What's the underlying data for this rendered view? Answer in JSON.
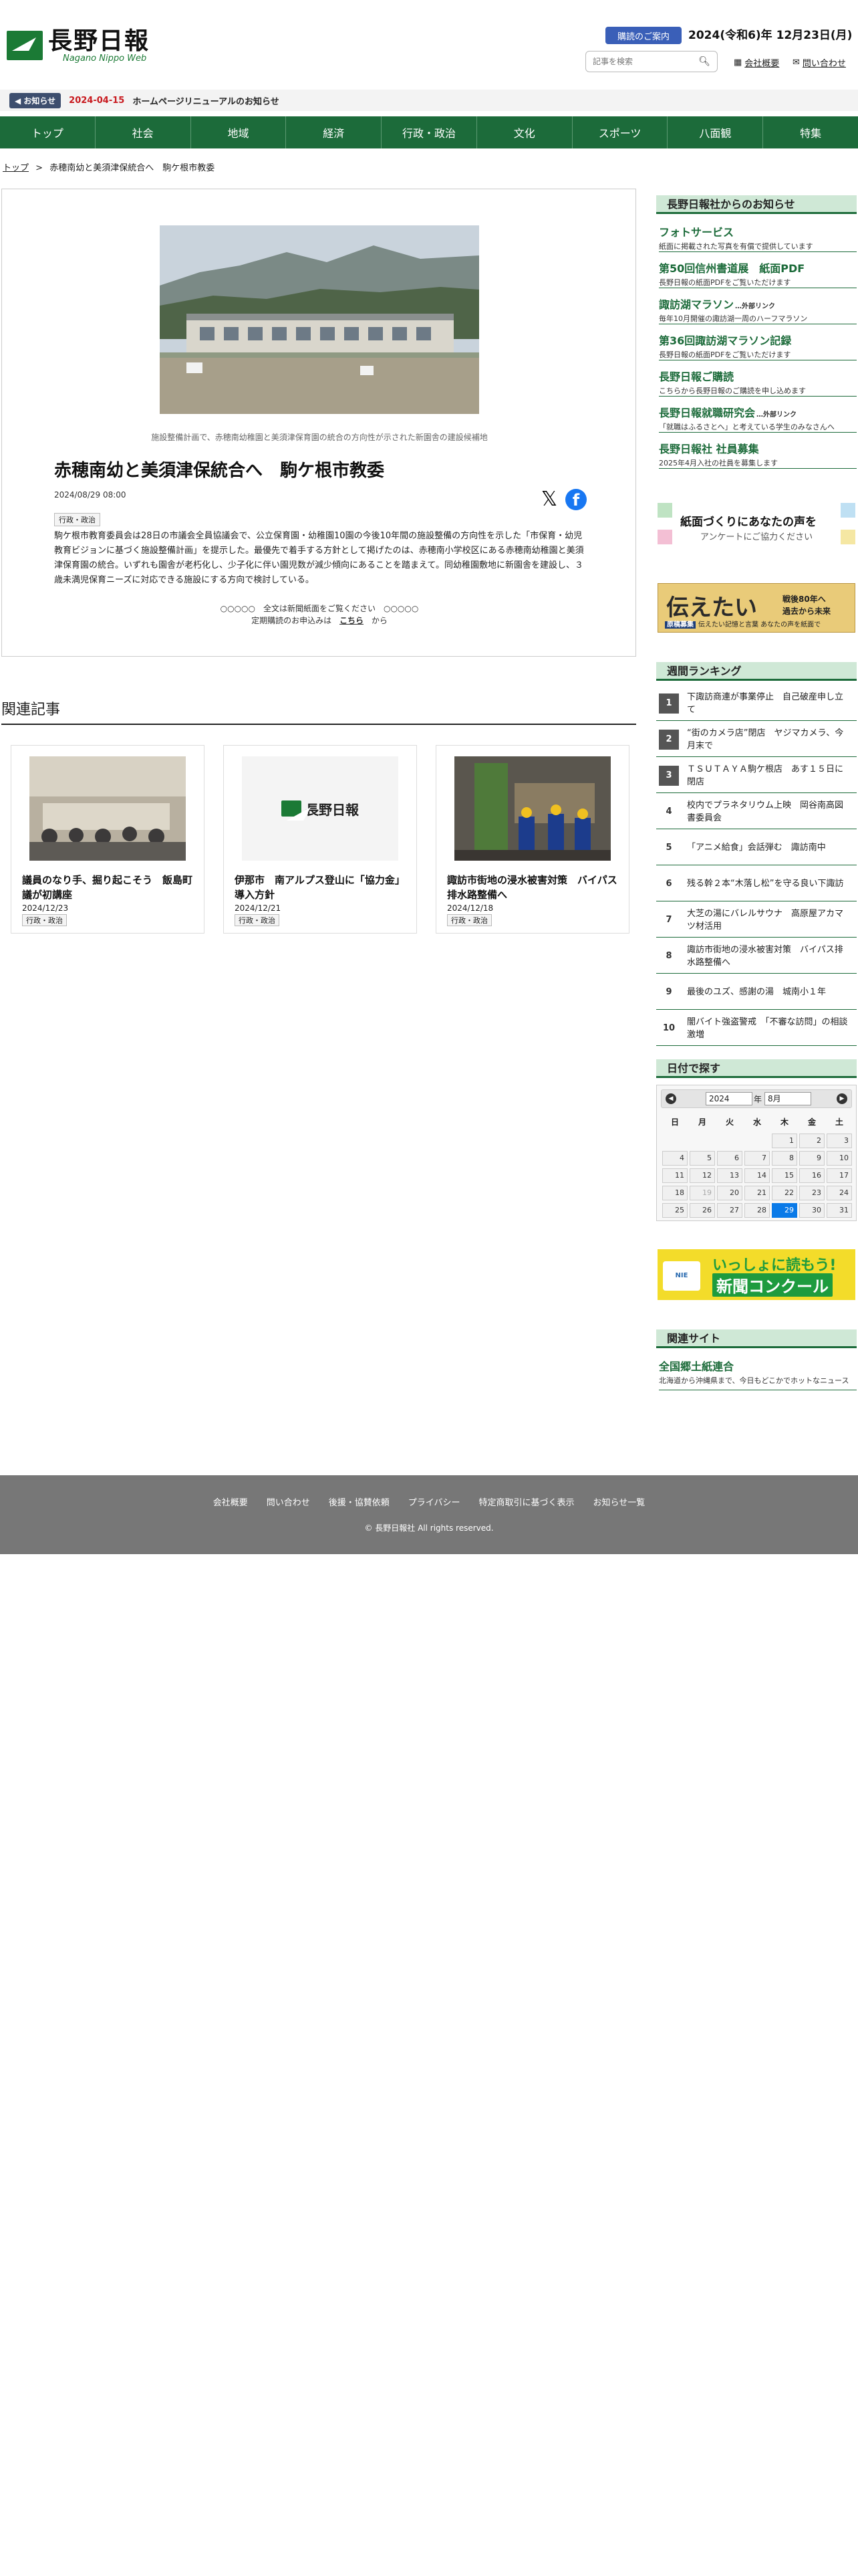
{
  "header": {
    "logo_title": "長野日報",
    "logo_sub": "Nagano Nippo Web",
    "subscribe_label": "購読のご案内",
    "date": "2024(令和6)年 12月23日(月)",
    "search_placeholder": "記事を検索",
    "company_link": "会社概要",
    "contact_link": "問い合わせ"
  },
  "notice": {
    "badge": "◀ お知らせ",
    "date": "2024-04-15",
    "text": "ホームページリニューアルのお知らせ"
  },
  "nav": [
    "トップ",
    "社会",
    "地域",
    "経済",
    "行政・政治",
    "文化",
    "スポーツ",
    "八面観",
    "特集"
  ],
  "breadcrumb": {
    "top": "トップ",
    "sep": ">",
    "current": "赤穂南幼と美須津保統合へ　駒ケ根市教委"
  },
  "article": {
    "caption": "施設整備計画で、赤穂南幼稚園と美須津保育園の統合の方向性が示された新園舎の建設候補地",
    "title": "赤穂南幼と美須津保統合へ　駒ケ根市教委",
    "date": "2024/08/29 08:00",
    "category": "行政・政治",
    "body": "駒ケ根市教育委員会は28日の市議会全員協議会で、公立保育園・幼稚園10園の今後10年間の施設整備の方向性を示した「市保育・幼児教育ビジョンに基づく施設整備計画」を提示した。最優先で着手する方針として掲げたのは、赤穂南小学校区にある赤穂南幼稚園と美須津保育園の統合。いずれも園舎が老朽化し、少子化に伴い園児数が減少傾向にあることを踏まえて。同幼稚園敷地に新園舎を建設し、３歳未満児保育ニーズに対応できる施設にする方向で検討している。",
    "paywall_line1": "○○○○○　全文は新聞紙面をご覧ください　○○○○○",
    "paywall_pre": "定期購読のお申込みは",
    "paywall_link": "こちら",
    "paywall_post": "から"
  },
  "related": {
    "heading": "関連記事",
    "items": [
      {
        "title": "議員のなり手、掘り起こそう　飯島町議が初講座",
        "date": "2024/12/23",
        "tag": "行政・政治"
      },
      {
        "title": "伊那市　南アルプス登山に「協力金」導入方針",
        "date": "2024/12/21",
        "tag": "行政・政治"
      },
      {
        "title": "諏訪市街地の浸水被害対策　バイパス排水路整備へ",
        "date": "2024/12/18",
        "tag": "行政・政治"
      }
    ]
  },
  "sidebar": {
    "news_heading": "長野日報社からのお知らせ",
    "news": [
      {
        "title": "フォトサービス",
        "badge": "",
        "sub": "紙面に掲載された写真を有償で提供しています"
      },
      {
        "title": "第50回信州書道展　紙面PDF",
        "badge": "",
        "sub": "長野日報の紙面PDFをご覧いただけます"
      },
      {
        "title": "諏訪湖マラソン",
        "badge": "…外部リンク",
        "sub": "毎年10月開催の諏訪湖一周のハーフマラソン"
      },
      {
        "title": "第36回諏訪湖マラソン記録",
        "badge": "",
        "sub": "長野日報の紙面PDFをご覧いただけます"
      },
      {
        "title": "長野日報ご購読",
        "badge": "",
        "sub": "こちらから長野日報のご購読を申し込めます"
      },
      {
        "title": "長野日報就職研究会",
        "badge": "…外部リンク",
        "sub": "「就職はふるさとへ」と考えている学生のみなさんへ"
      },
      {
        "title": "長野日報社 社員募集",
        "badge": "",
        "sub": "2025年4月入社の社員を募集します"
      }
    ],
    "banner1_title": "紙面づくりにあなたの声を",
    "banner1_sub": "アンケートにご協力ください",
    "banner2_big": "伝えたい",
    "banner2_r1": "戦後80年へ",
    "banner2_r2": "過去から未来",
    "banner2_badge": "原稿募集",
    "banner2_bar": "伝えたい記憶と言葉 あなたの声を紙面で",
    "ranking_heading": "週間ランキング",
    "ranking": [
      "下諏訪商連が事業停止　自己破産申し立て",
      "“街のカメラ店”閉店　ヤジマカメラ、今月末で",
      "ＴＳＵＴＡＹＡ駒ケ根店　あす１５日に閉店",
      "校内でプラネタリウム上映　岡谷南高図書委員会",
      "「アニメ給食」会話弾む　諏訪南中",
      "残る幹２本“木落し松”を守る良い下諏訪",
      "大芝の湯にバレルサウナ　高原屋アカマツ材活用",
      "諏訪市街地の浸水被害対策　バイパス排水路整備へ",
      "最後のユズ、感謝の湯　城南小１年",
      "闇バイト強盗警戒　「不審な訪問」の相談激増"
    ],
    "rank_nums": [
      "1",
      "2",
      "3",
      "4",
      "5",
      "6",
      "7",
      "8",
      "9",
      "10"
    ],
    "calendar_heading": "日付で探す",
    "calendar": {
      "year": "2024",
      "year_suffix": "年",
      "month": "8月",
      "dow": [
        "日",
        "月",
        "火",
        "水",
        "木",
        "金",
        "土"
      ],
      "weeks": [
        [
          "",
          "",
          "",
          "",
          "1",
          "2",
          "3"
        ],
        [
          "4",
          "5",
          "6",
          "7",
          "8",
          "9",
          "10"
        ],
        [
          "11",
          "12",
          "13",
          "14",
          "15",
          "16",
          "17"
        ],
        [
          "18",
          "19",
          "20",
          "21",
          "22",
          "23",
          "24"
        ],
        [
          "25",
          "26",
          "27",
          "28",
          "29",
          "30",
          "31"
        ]
      ],
      "selected": "29",
      "dimmed": [
        "19"
      ],
      "prev": "◀",
      "next": "▶"
    },
    "banner3_logo": "NIE",
    "banner3_t1": "いっしょに読もう!",
    "banner3_t2": "新聞コンクール",
    "related_sites_heading": "関連サイト",
    "related_site_title": "全国郷土紙連合",
    "related_site_sub": "北海道から沖縄県まで、今日もどこかでホットなニュース"
  },
  "footer": {
    "links": [
      "会社概要",
      "問い合わせ",
      "後援・協賛依頼",
      "プライバシー",
      "特定商取引に基づく表示",
      "お知らせ一覧"
    ],
    "copyright": "© 長野日報社 All rights reserved."
  },
  "colors": {
    "brand_green": "#1c6b3a",
    "notice_red": "#c8191e",
    "subscribe_blue": "#3a5fb8",
    "footer_gray": "#777777"
  }
}
